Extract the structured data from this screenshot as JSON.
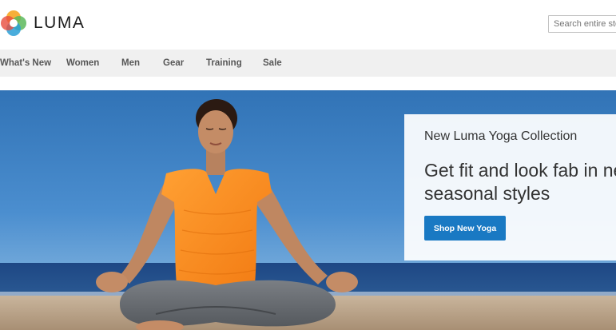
{
  "brand": {
    "name": "LUMA"
  },
  "search": {
    "placeholder": "Search entire store here..."
  },
  "nav": {
    "items": [
      {
        "label": "What's New"
      },
      {
        "label": "Women"
      },
      {
        "label": "Men"
      },
      {
        "label": "Gear"
      },
      {
        "label": "Training"
      },
      {
        "label": "Sale"
      }
    ]
  },
  "hero": {
    "subtitle": "New Luma Yoga Collection",
    "title_line1": "Get fit and look fab in new",
    "title_line2": "seasonal styles",
    "cta_label": "Shop New Yoga"
  },
  "colors": {
    "accent": "#1979c3",
    "nav_bg": "#f0f0f0",
    "sky": "#3f82c4",
    "sea": "#1b3f78",
    "sand": "#b9a48d",
    "shirt": "#ff8a1e"
  },
  "icons": {
    "logo": "luma-logo-icon"
  }
}
